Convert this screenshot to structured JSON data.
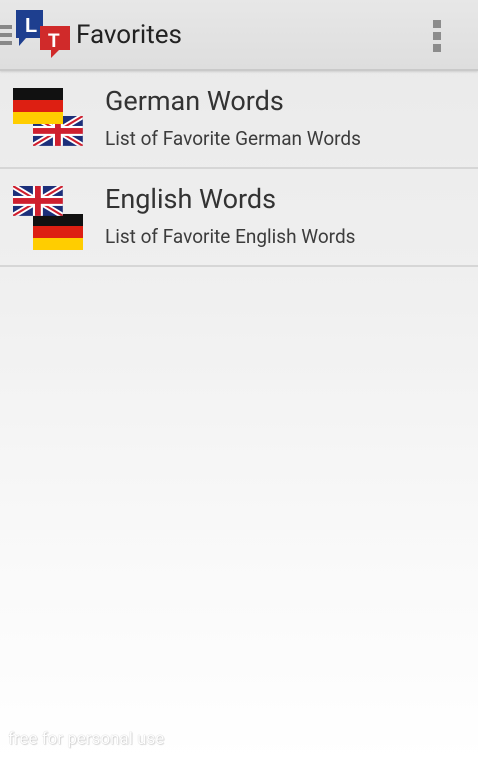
{
  "app": {
    "logo_icon": "lingua-translate-logo-icon",
    "logo_letters": [
      "L",
      "T"
    ],
    "colors": {
      "logo_blue": "#1e3f8f",
      "logo_red": "#d02a2a",
      "action_bar": "#e2e2e2",
      "title_text": "#222222"
    }
  },
  "action_bar": {
    "title": "Favorites",
    "drawer_icon": "menu-indicator-icon",
    "overflow_icon": "overflow-menu-icon"
  },
  "favorites": [
    {
      "title": "German Words",
      "subtitle": "List of Favorite German Words",
      "front_flag": "germany",
      "back_flag": "united-kingdom"
    },
    {
      "title": "English Words",
      "subtitle": "List of Favorite English Words",
      "front_flag": "united-kingdom",
      "back_flag": "germany"
    }
  ],
  "watermark": "free for personal use"
}
